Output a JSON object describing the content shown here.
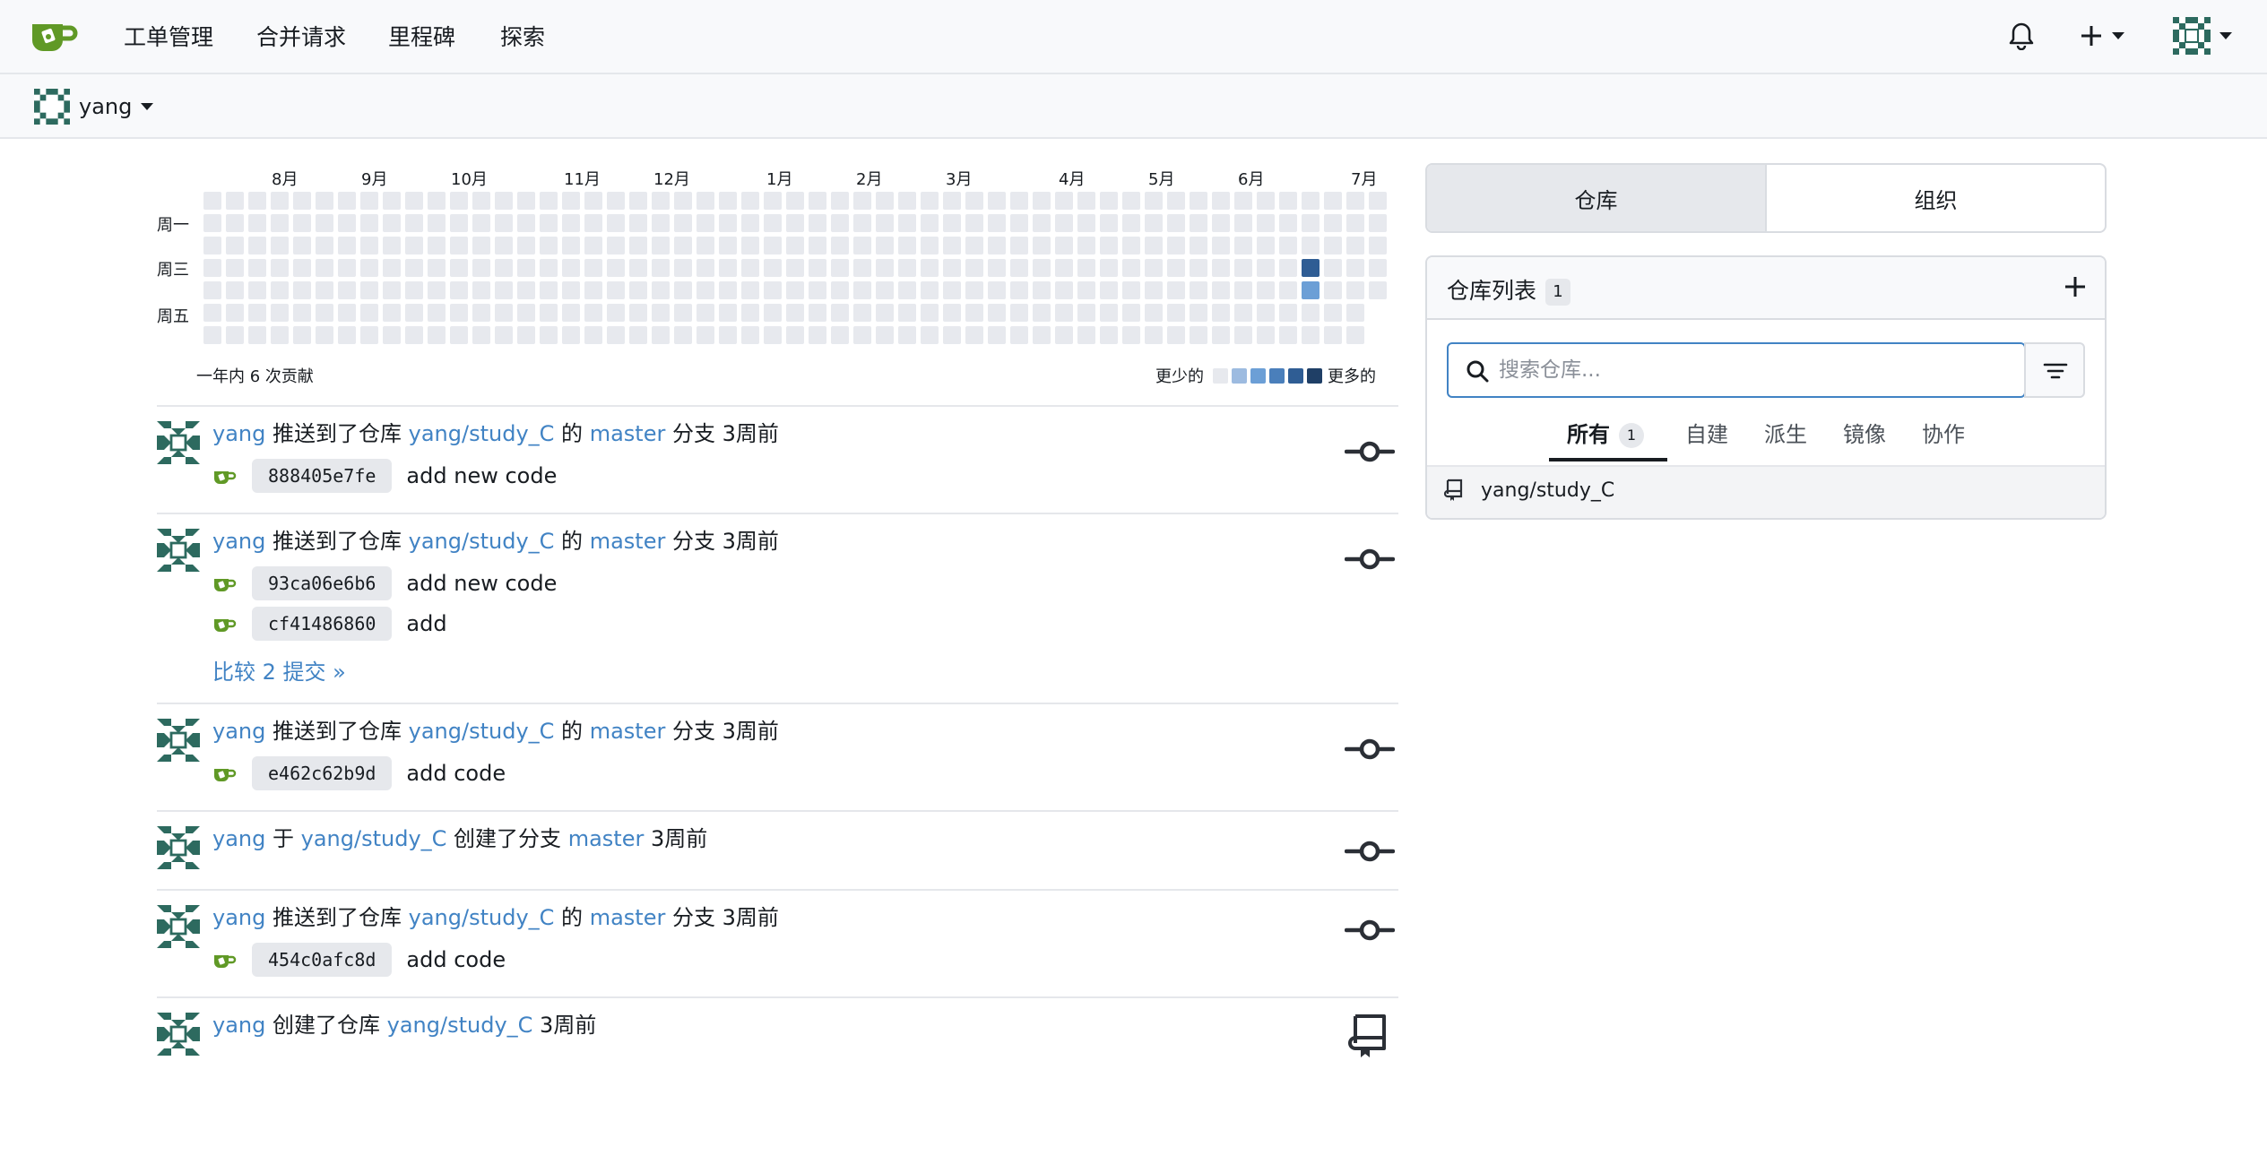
{
  "navbar": {
    "items": [
      "工单管理",
      "合并请求",
      "里程碑",
      "探索"
    ],
    "icons": [
      "bell-icon",
      "plus-icon",
      "avatar"
    ]
  },
  "context": {
    "user": "yang"
  },
  "heatmap": {
    "months": [
      "8月",
      "9月",
      "10月",
      "11月",
      "12月",
      "1月",
      "2月",
      "3月",
      "4月",
      "5月",
      "6月",
      "7月"
    ],
    "days": [
      "周一",
      "周三",
      "周五"
    ],
    "total_text": "一年内 6 次贡献",
    "legend_less": "更少的",
    "legend_more": "更多的",
    "colors": {
      "empty": "#e7e9ee",
      "lvl1": "#9dbbe0",
      "lvl2": "#6c9fd6",
      "lvl3": "#4a7fbb",
      "lvl4": "#2f5d94",
      "lvl5": "#1f3f66"
    },
    "active_cells": [
      {
        "week": 49,
        "day": 3,
        "level": 4
      },
      {
        "week": 49,
        "day": 4,
        "level": 2
      }
    ]
  },
  "feed": [
    {
      "user": "yang",
      "action": "推送到了仓库",
      "repo": "yang/study_C",
      "of": "的",
      "branch": "master",
      "branch_suffix": "分支",
      "time": "3周前",
      "commits": [
        {
          "sha": "888405e7fe",
          "msg": "add new code"
        }
      ]
    },
    {
      "user": "yang",
      "action": "推送到了仓库",
      "repo": "yang/study_C",
      "of": "的",
      "branch": "master",
      "branch_suffix": "分支",
      "time": "3周前",
      "commits": [
        {
          "sha": "93ca06e6b6",
          "msg": "add new code"
        },
        {
          "sha": "cf41486860",
          "msg": "add"
        }
      ],
      "compare": "比较 2 提交 »"
    },
    {
      "user": "yang",
      "action": "推送到了仓库",
      "repo": "yang/study_C",
      "of": "的",
      "branch": "master",
      "branch_suffix": "分支",
      "time": "3周前",
      "commits": [
        {
          "sha": "e462c62b9d",
          "msg": "add code"
        }
      ]
    },
    {
      "user": "yang",
      "at": "于",
      "repo": "yang/study_C",
      "action2": "创建了分支",
      "branch": "master",
      "time": "3周前"
    },
    {
      "user": "yang",
      "action": "推送到了仓库",
      "repo": "yang/study_C",
      "of": "的",
      "branch": "master",
      "branch_suffix": "分支",
      "time": "3周前",
      "commits": [
        {
          "sha": "454c0afc8d",
          "msg": "add code"
        }
      ]
    },
    {
      "user": "yang",
      "action": "创建了仓库",
      "repo": "yang/study_C",
      "time": "3周前"
    }
  ],
  "right": {
    "tab_repos": "仓库",
    "tab_orgs": "组织",
    "list_title": "仓库列表",
    "list_count": "1",
    "search_placeholder": "搜索仓库...",
    "subtabs": [
      "所有",
      "自建",
      "派生",
      "镜像",
      "协作"
    ],
    "all_count": "1",
    "repos": [
      "yang/study_C"
    ]
  }
}
